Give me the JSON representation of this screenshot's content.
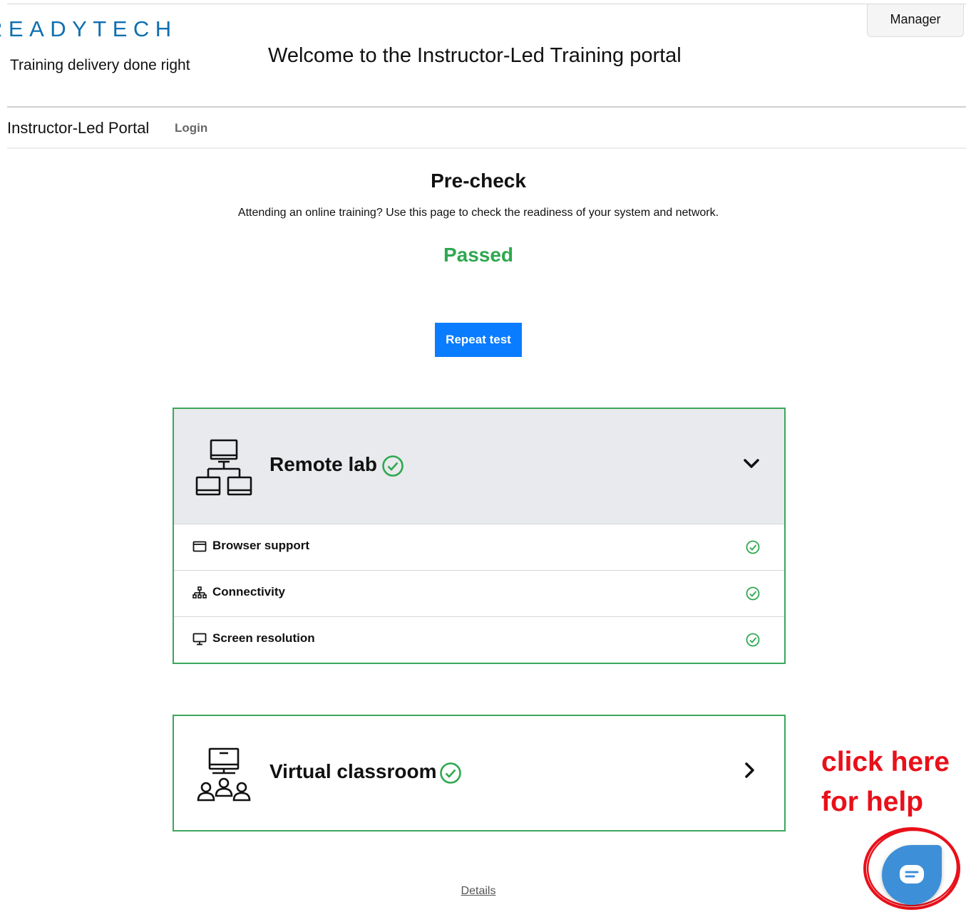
{
  "header": {
    "brand": "READYTECH",
    "tagline": "Training delivery done right",
    "welcome": "Welcome to the Instructor-Led Training portal",
    "manager_label": "Manager"
  },
  "nav": {
    "portal_label": "Instructor-Led Portal",
    "login_label": "Login"
  },
  "main": {
    "title": "Pre-check",
    "subtitle": "Attending an online training? Use this page to check the readiness of your system and network.",
    "status": "Passed",
    "repeat_label": "Repeat test"
  },
  "remote_lab": {
    "title": "Remote lab",
    "icon": "network-computers-icon",
    "expanded": true,
    "checks": [
      {
        "label": "Browser support",
        "icon": "browser-window-icon",
        "passed": true
      },
      {
        "label": "Connectivity",
        "icon": "network-icon",
        "passed": true
      },
      {
        "label": "Screen resolution",
        "icon": "monitor-icon",
        "passed": true
      }
    ]
  },
  "virtual_classroom": {
    "title": "Virtual classroom",
    "icon": "classroom-icon",
    "expanded": false
  },
  "footer": {
    "details_label": "Details"
  },
  "annotation": {
    "line1": "click here",
    "line2": "for help"
  },
  "colors": {
    "success": "#2fa84f",
    "primary": "#0a7cff",
    "card_border": "#3ca65b",
    "annotation": "#e8101a",
    "chat": "#3d8fd8"
  }
}
